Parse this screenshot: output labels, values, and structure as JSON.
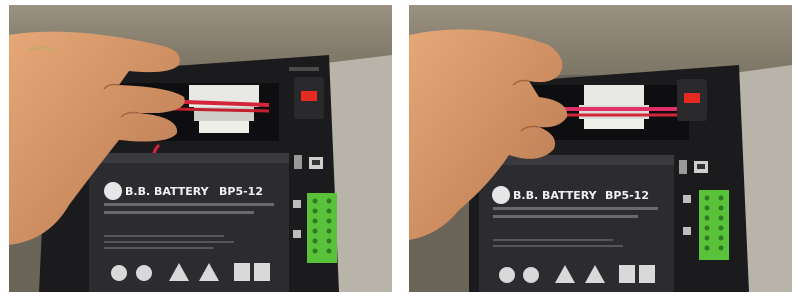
{
  "photos": [
    {
      "battery": {
        "brand": "B.B. BATTERY",
        "model": "BP5-12"
      }
    },
    {
      "battery": {
        "brand": "B.B. BATTERY",
        "model": "BP5-12"
      }
    }
  ],
  "colors": {
    "wall": "#8a8272",
    "desk": "#b9b4aa",
    "chassis": "#1b1b1d",
    "battery": "#2c2c30",
    "skin": "#d99a6c",
    "wire_red": "#d3263a",
    "connector": "#e8e8e4",
    "led_red": "#e52a22",
    "terminal_green": "#59c23a"
  },
  "icons": [
    "hand",
    "battery",
    "connector-plug",
    "usb-port",
    "green-terminal-block",
    "red-led-display"
  ]
}
